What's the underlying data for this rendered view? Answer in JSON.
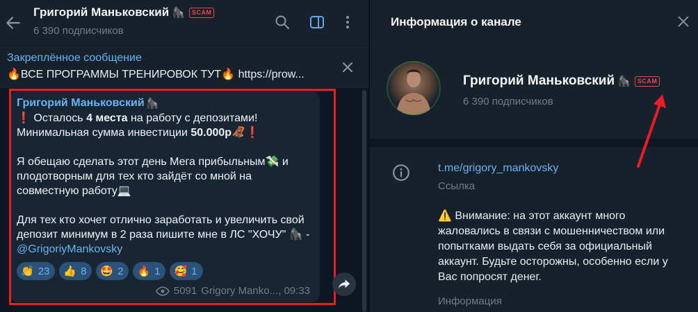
{
  "chat": {
    "title": "Григорий Маньковский",
    "title_emoji": "🦍",
    "scam_badge": "SCAM",
    "subscribers": "6 390 подписчиков",
    "pinned": {
      "title": "Закреплённое сообщение",
      "text": "🔥ВСЕ ПРОГРАММЫ ТРЕНИРОВОК ТУТ🔥  https://prow..."
    },
    "message": {
      "author": "Григорий Маньковский",
      "author_emoji": "🦍",
      "line1_a": "❗ Осталось ",
      "line1_b": "4 места",
      "line1_c": " на работу с депозитами!",
      "line2_a": "Минимальная сумма инвестиции ",
      "line2_b": "50.000р",
      "line2_c": "🦧❗",
      "para2": "Я обещаю сделать этот день Мега прибыльным💸 и плодотворным для тех кто зайдёт со мной на совместную работу💻",
      "para3": "Для тех кто хочет отлично заработать и увеличить свой депозит минимум в 2 раза пишите мне в ЛС \"ХОЧУ\" 🦍 - ",
      "mention": "@GrigoriyMankovsky",
      "reactions": [
        {
          "emoji": "👏",
          "count": "23"
        },
        {
          "emoji": "👍",
          "count": "8"
        },
        {
          "emoji": "🤩",
          "count": "2"
        },
        {
          "emoji": "🔥",
          "count": "1"
        },
        {
          "emoji": "🥰",
          "count": "1"
        }
      ],
      "views": "5091",
      "signature_time": "Grigory Manko..., 09:33"
    }
  },
  "info": {
    "title": "Информация о канале",
    "name": "Григорий Маньковский",
    "name_emoji": "🦍",
    "scam_badge": "SCAM",
    "subscribers": "6 390 подписчиков",
    "link": "t.me/grigory_mankovsky",
    "link_caption": "Ссылка",
    "warning_icon": "⚠️",
    "warning": "Внимание: на этот аккаунт много жаловались в связи с мошенничеством или попытками выдать себя за официальный аккаунт. Будьте осторожны, особенно если у Вас попросят денег.",
    "warning_caption": "Информация"
  },
  "colors": {
    "accent": "#6ab3f3",
    "scam": "#e5484d",
    "highlight_frame": "#e81d25",
    "bubble": "#182533",
    "panel": "#17212b"
  }
}
